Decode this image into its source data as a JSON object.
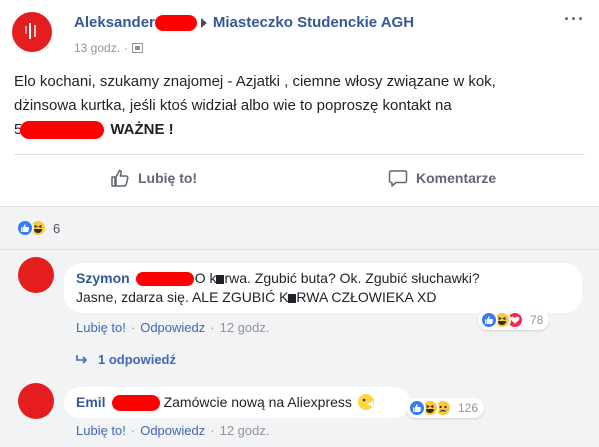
{
  "post": {
    "author": "Aleksander",
    "group": "Miasteczko Studenckie AGH",
    "time": "13 godz.",
    "text_line1": "Elo kochani, szukamy znajomej - Azjatki , ciemne włosy związane w kok,",
    "text_line2": "dżinsowa kurtka, jeśli ktoś widział albo wie to poproszę kontakt na",
    "text_line3_prefix": "5",
    "text_line3_bold": "WAŻNE !",
    "like_label": "Lubię to!",
    "comment_label": "Komentarze",
    "reaction_count": "6",
    "icons": {
      "more": "more-options-icon",
      "audience": "audience-icon",
      "like": "thumbs-up-icon",
      "comment": "comment-icon"
    }
  },
  "comments": [
    {
      "author": "Szymon",
      "text_a": "O k",
      "text_b": "rwa. Zgubić buta? Ok. Zgubić słuchawki?",
      "text_line2_a": "Jasne, zdarza się. ALE ZGUBIĆ K",
      "text_line2_b": "RWA CZŁOWIEKA XD",
      "like": "Lubię to!",
      "reply": "Odpowiedz",
      "time": "12 godz.",
      "reaction_count": "78"
    },
    {
      "author": "Emil",
      "text": "Zamówcie nową na Aliexpress",
      "like": "Lubię to!",
      "reply": "Odpowiedz",
      "time": "12 godz.",
      "reaction_count": "126"
    }
  ],
  "reply_toggle": "1 odpowiedź",
  "colors": {
    "link": "#365899",
    "accent": "#4267b2",
    "redaction": "#ff0000",
    "like": "#3b7af5",
    "haha": "#fcc73b",
    "love": "#f0284a"
  }
}
